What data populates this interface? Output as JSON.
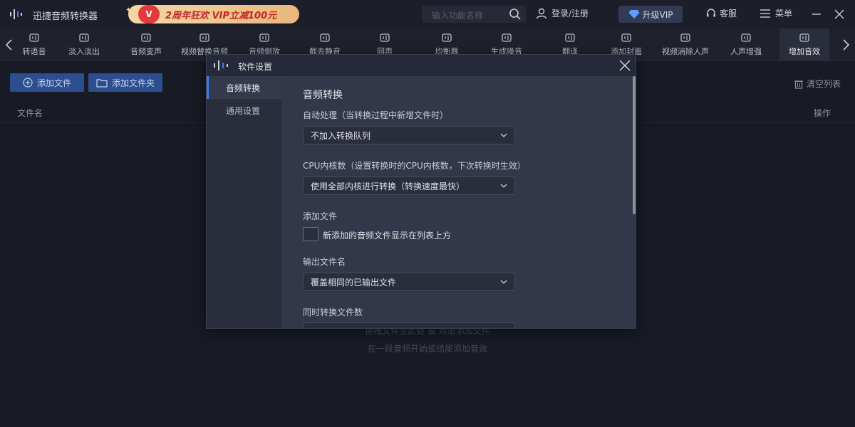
{
  "app": {
    "title": "迅捷音频转换器"
  },
  "promo": {
    "badge": "V",
    "text": "2周年狂欢 VIP立减100元"
  },
  "search": {
    "placeholder": "输入功能名称"
  },
  "header": {
    "login": "登录/注册",
    "vip": "升级VIP",
    "service": "客服",
    "menu": "菜单"
  },
  "toolbar": {
    "items": [
      {
        "label": "转语音",
        "icon": "text-to-speech-icon"
      },
      {
        "label": "淡入淡出",
        "icon": "fade-icon"
      },
      {
        "label": "音频变声",
        "icon": "voice-change-icon"
      },
      {
        "label": "视频替换音频",
        "icon": "video-replace-icon"
      },
      {
        "label": "音频倒放",
        "icon": "reverse-icon"
      },
      {
        "label": "截去静音",
        "icon": "mute-cut-icon"
      },
      {
        "label": "回声",
        "icon": "echo-icon"
      },
      {
        "label": "均衡器",
        "icon": "equalizer-icon"
      },
      {
        "label": "生成噪音",
        "icon": "noise-icon"
      },
      {
        "label": "翻译",
        "icon": "translate-icon"
      },
      {
        "label": "添加封面",
        "icon": "cover-icon"
      },
      {
        "label": "视频消除人声",
        "icon": "vocal-remove-icon"
      },
      {
        "label": "人声增强",
        "icon": "vocal-enhance-icon"
      },
      {
        "label": "增加音效",
        "icon": "sound-effect-icon"
      }
    ]
  },
  "main": {
    "add_file": "添加文件",
    "add_folder": "添加文件夹",
    "clear_list": "清空列表",
    "col_file": "文件名",
    "col_op": "操作",
    "drop_hint": "拖拽文件至此处 或 点击添加文件",
    "drop_sub": "在一段音频开始或结尾添加音效"
  },
  "dialog": {
    "title": "软件设置",
    "nav": [
      "音频转换",
      "通用设置"
    ],
    "section_title": "音频转换",
    "auto_label": "自动处理（当转换过程中新增文件时）",
    "auto_value": "不加入转换队列",
    "cpu_label": "CPU内核数（设置转换时的CPU内核数，下次转换时生效）",
    "cpu_value": "使用全部内核进行转换（转换速度最快）",
    "add_label": "添加文件",
    "add_check": "新添加的音频文件显示在列表上方",
    "output_label": "输出文件名",
    "output_value": "覆盖相同的已输出文件",
    "concurrent_label": "同时转换文件数"
  },
  "colors": {
    "accent": "#3f7cf0",
    "button": "#2c4e8e",
    "promo_text": "#c4262a"
  }
}
